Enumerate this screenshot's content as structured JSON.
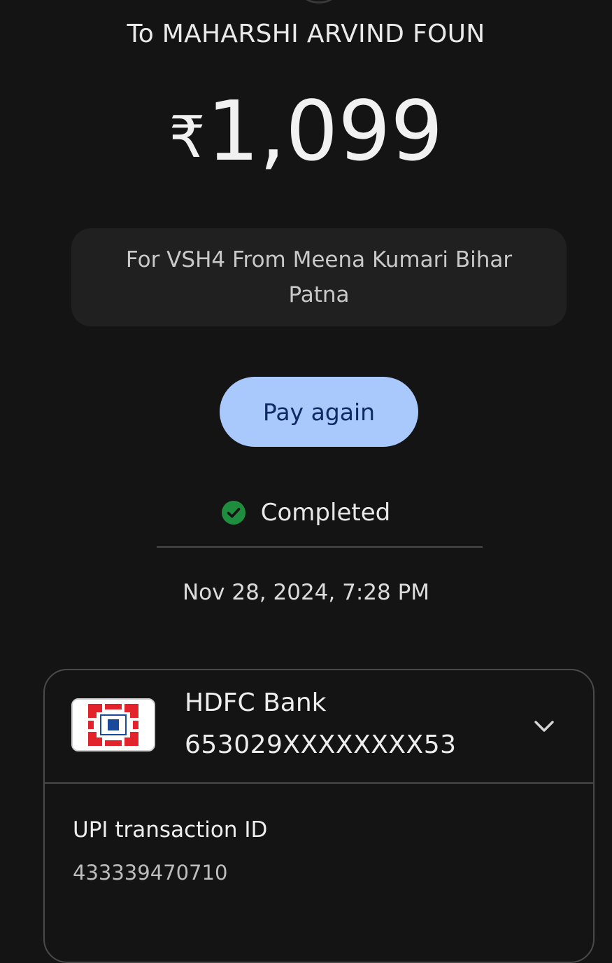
{
  "header": {
    "recipient": "To MAHARSHI ARVIND FOUN"
  },
  "payment": {
    "currency_symbol": "₹",
    "amount": "1,099",
    "note": "For VSH4 From Meena Kumari Bihar Patna"
  },
  "actions": {
    "pay_again_label": "Pay again"
  },
  "status": {
    "label": "Completed",
    "icon": "check-circle-icon",
    "color": "#1e8e3e"
  },
  "datetime": "Nov 28, 2024, 7:28 PM",
  "bank": {
    "name": "HDFC Bank",
    "account_number": "653029XXXXXXXX53",
    "logo_colors": {
      "red": "#e3232b",
      "blue": "#1b4a9b"
    }
  },
  "transaction": {
    "upi_label": "UPI transaction ID",
    "upi_id": "433339470710"
  },
  "theme": {
    "background": "#141414",
    "accent": "#a9c8fb",
    "accent_text": "#0f2a63"
  }
}
